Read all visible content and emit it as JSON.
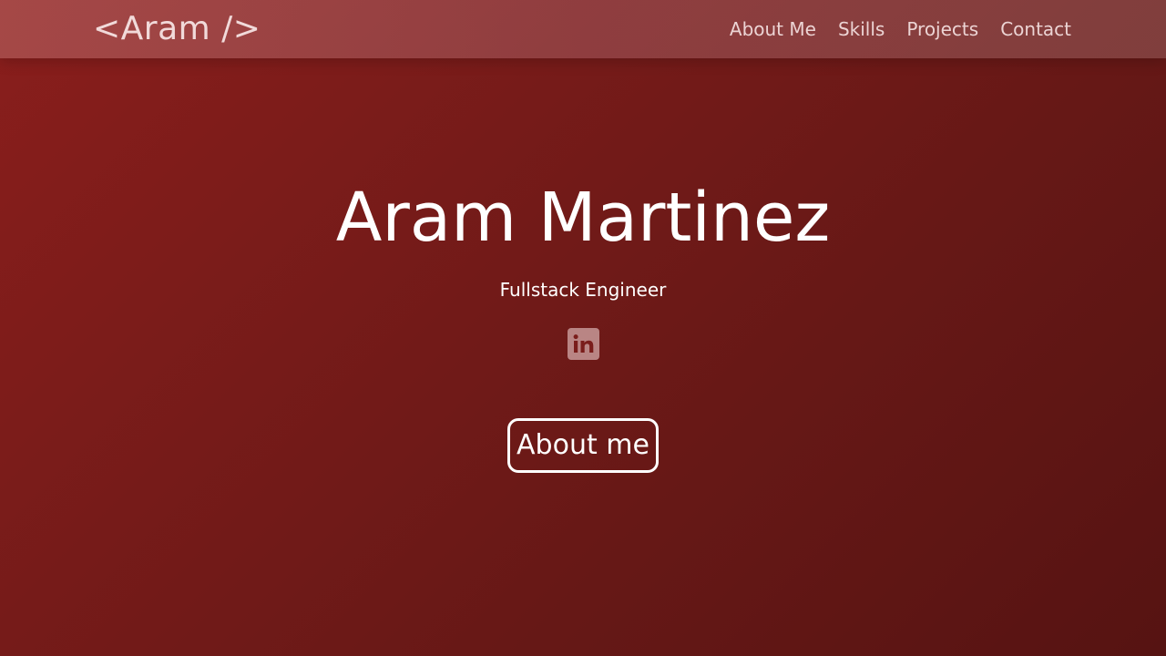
{
  "nav": {
    "brand": "<Aram />",
    "links": [
      {
        "label": "About Me"
      },
      {
        "label": "Skills"
      },
      {
        "label": "Projects"
      },
      {
        "label": "Contact"
      }
    ]
  },
  "hero": {
    "name": "Aram Martinez",
    "tagline": "Fullstack Engineer",
    "social_icons": [
      "linkedin-icon"
    ],
    "cta_label": "About me"
  },
  "colors": {
    "background_start": "#8a1e1c",
    "background_end": "#561312",
    "text": "#ffffff",
    "nav_text": "#ecd4d4",
    "linkedin_tile": "#d7afaf",
    "linkedin_glyph": "#7a1d1b"
  }
}
